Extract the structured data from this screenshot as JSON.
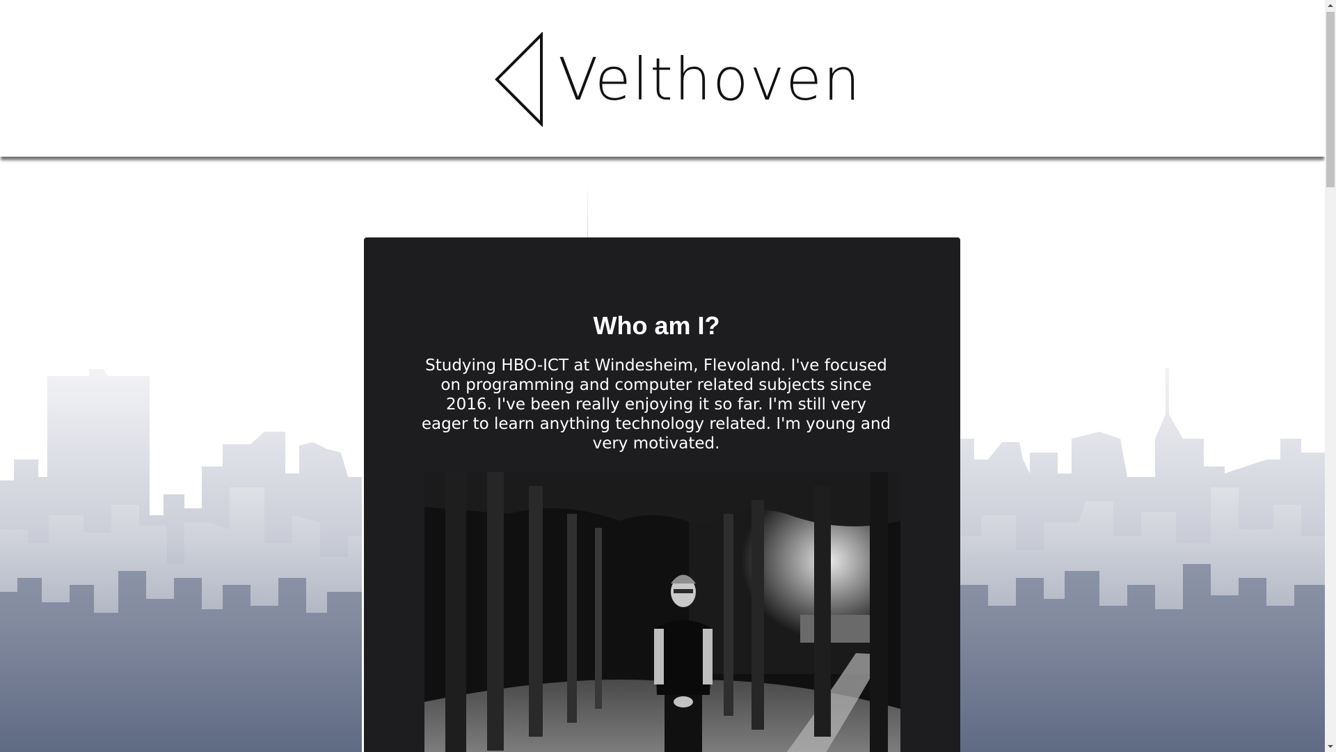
{
  "header": {
    "logo_text": "Velthoven"
  },
  "about": {
    "title": "Who am I?",
    "text": "Studying HBO-ICT at Windesheim, Flevoland. I've focused on programming and computer related subjects since 2016. I've been really enjoying it so far. I'm still very eager to learn anything technology related. I'm young and very motivated."
  },
  "icons": {
    "logo": "triangle-logo-icon",
    "scroll_up": "chevron-up-icon",
    "scroll_down": "chevron-down-icon"
  },
  "colors": {
    "card_background": "#1d1d20",
    "page_background": "#ffffff",
    "skyline_light": "#eeeff3",
    "skyline_dark": "#6e7890"
  }
}
